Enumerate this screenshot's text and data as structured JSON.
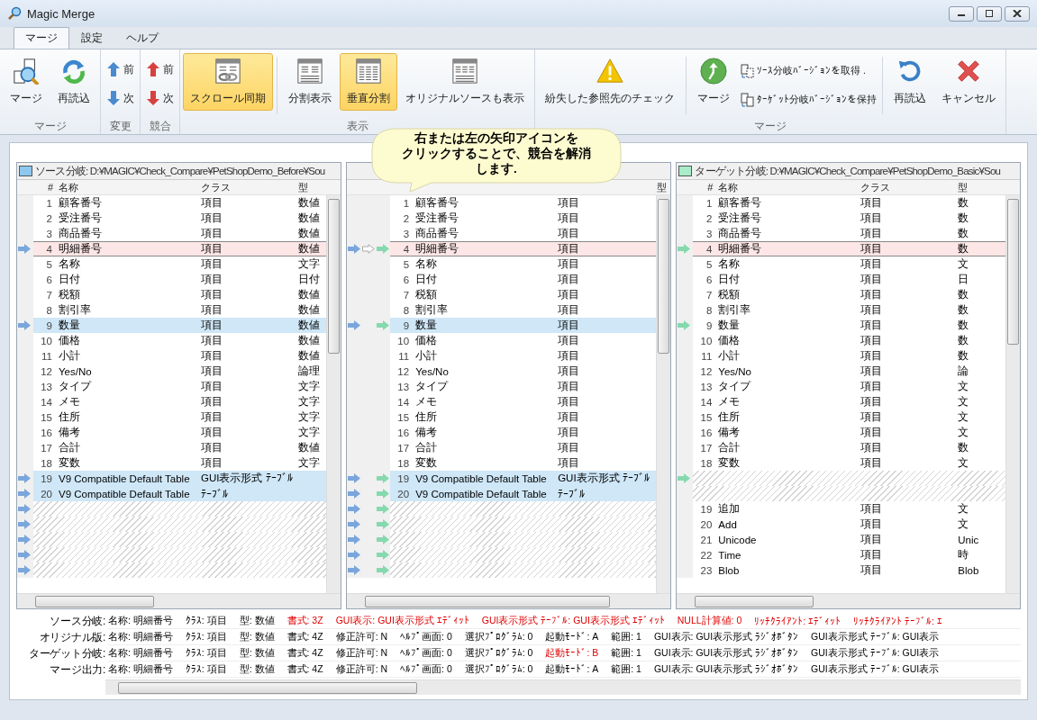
{
  "window": {
    "title": "Magic Merge"
  },
  "tabs": [
    {
      "label": "マージ",
      "selected": true
    },
    {
      "label": "設定",
      "selected": false
    },
    {
      "label": "ヘルプ",
      "selected": false
    }
  ],
  "ribbon": [
    {
      "label": "マージ",
      "items": [
        {
          "kind": "large",
          "label": "マージ",
          "selected": false
        },
        {
          "kind": "large",
          "label": "再読込",
          "selected": false
        }
      ]
    },
    {
      "label": "変更",
      "items": [
        {
          "kind": "small",
          "label": "前"
        },
        {
          "kind": "small",
          "label": "次"
        }
      ]
    },
    {
      "label": "競合",
      "items": [
        {
          "kind": "small",
          "label": "前"
        },
        {
          "kind": "small",
          "label": "次"
        }
      ]
    },
    {
      "label": "表示",
      "items": [
        {
          "kind": "large",
          "label": "スクロール同期",
          "selected": true
        },
        {
          "kind": "divider"
        },
        {
          "kind": "large",
          "label": "分割表示",
          "selected": false
        },
        {
          "kind": "large",
          "label": "垂直分割",
          "selected": true
        },
        {
          "kind": "large",
          "label": "オリジナルソースも表示",
          "selected": false
        }
      ]
    },
    {
      "label": "マージ",
      "items": [
        {
          "kind": "large",
          "label": "紛失した参照先のチェック",
          "selected": false
        },
        {
          "kind": "divider"
        },
        {
          "kind": "large",
          "label": "マージ",
          "selected": false
        },
        {
          "kind": "stack",
          "entries": [
            {
              "label": "ｿｰｽ分岐ﾊﾞｰｼﾞｮﾝを取得 ."
            },
            {
              "label": "ﾀｰｹﾞｯﾄ分岐ﾊﾞｰｼﾞｮﾝを保持"
            }
          ]
        },
        {
          "kind": "divider"
        },
        {
          "kind": "large",
          "label": "再読込",
          "selected": false
        },
        {
          "kind": "large",
          "label": "キャンセル",
          "selected": false
        }
      ]
    }
  ],
  "callout": {
    "lines": [
      "右または左の矢印アイコンを",
      "クリックすることで、競合を解消",
      "します."
    ]
  },
  "panels": [
    {
      "kind": "source",
      "title": "ソース分岐: D:¥MAGIC¥Check_Compare¥PetShopDemo_Before¥Sou",
      "columns": [
        "#",
        "名称",
        "クラス",
        "型"
      ],
      "rows": [
        {
          "kind": "row",
          "conflict": false,
          "changed": false,
          "source_arrow": false,
          "num": "1",
          "name": "顧客番号",
          "class": "項目",
          "type": "数値"
        },
        {
          "kind": "row",
          "conflict": false,
          "changed": false,
          "source_arrow": false,
          "num": "2",
          "name": "受注番号",
          "class": "項目",
          "type": "数値"
        },
        {
          "kind": "row",
          "conflict": false,
          "changed": false,
          "source_arrow": false,
          "num": "3",
          "name": "商品番号",
          "class": "項目",
          "type": "数値"
        },
        {
          "kind": "row",
          "conflict": true,
          "changed": false,
          "source_arrow": true,
          "num": "4",
          "name": "明細番号",
          "class": "項目",
          "type": "数値"
        },
        {
          "kind": "row",
          "conflict": false,
          "changed": false,
          "source_arrow": false,
          "num": "5",
          "name": "名称",
          "class": "項目",
          "type": "文字"
        },
        {
          "kind": "row",
          "conflict": false,
          "changed": false,
          "source_arrow": false,
          "num": "6",
          "name": "日付",
          "class": "項目",
          "type": "日付"
        },
        {
          "kind": "row",
          "conflict": false,
          "changed": false,
          "source_arrow": false,
          "num": "7",
          "name": "税額",
          "class": "項目",
          "type": "数値"
        },
        {
          "kind": "row",
          "conflict": false,
          "changed": false,
          "source_arrow": false,
          "num": "8",
          "name": "割引率",
          "class": "項目",
          "type": "数値"
        },
        {
          "kind": "row",
          "conflict": false,
          "changed": true,
          "source_arrow": true,
          "num": "9",
          "name": "数量",
          "class": "項目",
          "type": "数値"
        },
        {
          "kind": "row",
          "conflict": false,
          "changed": false,
          "source_arrow": false,
          "num": "10",
          "name": "価格",
          "class": "項目",
          "type": "数値"
        },
        {
          "kind": "row",
          "conflict": false,
          "changed": false,
          "source_arrow": false,
          "num": "11",
          "name": "小計",
          "class": "項目",
          "type": "数値"
        },
        {
          "kind": "row",
          "conflict": false,
          "changed": false,
          "source_arrow": false,
          "num": "12",
          "name": "Yes/No",
          "class": "項目",
          "type": "論理"
        },
        {
          "kind": "row",
          "conflict": false,
          "changed": false,
          "source_arrow": false,
          "num": "13",
          "name": "タイプ",
          "class": "項目",
          "type": "文字"
        },
        {
          "kind": "row",
          "conflict": false,
          "changed": false,
          "source_arrow": false,
          "num": "14",
          "name": "メモ",
          "class": "項目",
          "type": "文字"
        },
        {
          "kind": "row",
          "conflict": false,
          "changed": false,
          "source_arrow": false,
          "num": "15",
          "name": "住所",
          "class": "項目",
          "type": "文字"
        },
        {
          "kind": "row",
          "conflict": false,
          "changed": false,
          "source_arrow": false,
          "num": "16",
          "name": "備考",
          "class": "項目",
          "type": "文字"
        },
        {
          "kind": "row",
          "conflict": false,
          "changed": false,
          "source_arrow": false,
          "num": "17",
          "name": "合計",
          "class": "項目",
          "type": "数値"
        },
        {
          "kind": "row",
          "conflict": false,
          "changed": false,
          "source_arrow": false,
          "num": "18",
          "name": "変数",
          "class": "項目",
          "type": "文字"
        },
        {
          "kind": "row",
          "conflict": false,
          "changed": true,
          "source_arrow": true,
          "num": "19",
          "name": "V9 Compatible Default Table",
          "class": "GUI表示形式 ﾃｰﾌﾞﾙ"
        },
        {
          "kind": "row",
          "conflict": false,
          "changed": true,
          "source_arrow": true,
          "num": "20",
          "name": "V9 Compatible Default Table",
          "class": "ﾃｰﾌﾞﾙ"
        },
        {
          "kind": "empty",
          "source_arrow": true
        },
        {
          "kind": "empty",
          "source_arrow": true
        },
        {
          "kind": "empty",
          "source_arrow": true
        },
        {
          "kind": "empty",
          "source_arrow": true
        },
        {
          "kind": "empty",
          "source_arrow": true
        }
      ]
    },
    {
      "kind": "middle",
      "type_header": "型",
      "rows": [
        {
          "kind": "row",
          "conflict": false,
          "changed": false,
          "source_arrow": false,
          "original_arrow": false,
          "target_arrow": false,
          "num": "1",
          "name": "顧客番号",
          "class": "項目"
        },
        {
          "kind": "row",
          "conflict": false,
          "changed": false,
          "source_arrow": false,
          "original_arrow": false,
          "target_arrow": false,
          "num": "2",
          "name": "受注番号",
          "class": "項目"
        },
        {
          "kind": "row",
          "conflict": false,
          "changed": false,
          "source_arrow": false,
          "original_arrow": false,
          "target_arrow": false,
          "num": "3",
          "name": "商品番号",
          "class": "項目"
        },
        {
          "kind": "row",
          "conflict": true,
          "changed": false,
          "source_arrow": true,
          "original_arrow": true,
          "target_arrow": true,
          "num": "4",
          "name": "明細番号",
          "class": "項目"
        },
        {
          "kind": "row",
          "conflict": false,
          "changed": false,
          "source_arrow": false,
          "original_arrow": false,
          "target_arrow": false,
          "num": "5",
          "name": "名称",
          "class": "項目"
        },
        {
          "kind": "row",
          "conflict": false,
          "changed": false,
          "source_arrow": false,
          "original_arrow": false,
          "target_arrow": false,
          "num": "6",
          "name": "日付",
          "class": "項目"
        },
        {
          "kind": "row",
          "conflict": false,
          "changed": false,
          "source_arrow": false,
          "original_arrow": false,
          "target_arrow": false,
          "num": "7",
          "name": "税額",
          "class": "項目"
        },
        {
          "kind": "row",
          "conflict": false,
          "changed": false,
          "source_arrow": false,
          "original_arrow": false,
          "target_arrow": false,
          "num": "8",
          "name": "割引率",
          "class": "項目"
        },
        {
          "kind": "row",
          "conflict": false,
          "changed": true,
          "source_arrow": true,
          "original_arrow": false,
          "target_arrow": true,
          "num": "9",
          "name": "数量",
          "class": "項目"
        },
        {
          "kind": "row",
          "conflict": false,
          "changed": false,
          "source_arrow": false,
          "original_arrow": false,
          "target_arrow": false,
          "num": "10",
          "name": "価格",
          "class": "項目"
        },
        {
          "kind": "row",
          "conflict": false,
          "changed": false,
          "source_arrow": false,
          "original_arrow": false,
          "target_arrow": false,
          "num": "11",
          "name": "小計",
          "class": "項目"
        },
        {
          "kind": "row",
          "conflict": false,
          "changed": false,
          "source_arrow": false,
          "original_arrow": false,
          "target_arrow": false,
          "num": "12",
          "name": "Yes/No",
          "class": "項目"
        },
        {
          "kind": "row",
          "conflict": false,
          "changed": false,
          "source_arrow": false,
          "original_arrow": false,
          "target_arrow": false,
          "num": "13",
          "name": "タイプ",
          "class": "項目"
        },
        {
          "kind": "row",
          "conflict": false,
          "changed": false,
          "source_arrow": false,
          "original_arrow": false,
          "target_arrow": false,
          "num": "14",
          "name": "メモ",
          "class": "項目"
        },
        {
          "kind": "row",
          "conflict": false,
          "changed": false,
          "source_arrow": false,
          "original_arrow": false,
          "target_arrow": false,
          "num": "15",
          "name": "住所",
          "class": "項目"
        },
        {
          "kind": "row",
          "conflict": false,
          "changed": false,
          "source_arrow": false,
          "original_arrow": false,
          "target_arrow": false,
          "num": "16",
          "name": "備考",
          "class": "項目"
        },
        {
          "kind": "row",
          "conflict": false,
          "changed": false,
          "source_arrow": false,
          "original_arrow": false,
          "target_arrow": false,
          "num": "17",
          "name": "合計",
          "class": "項目"
        },
        {
          "kind": "row",
          "conflict": false,
          "changed": false,
          "source_arrow": false,
          "original_arrow": false,
          "target_arrow": false,
          "num": "18",
          "name": "変数",
          "class": "項目"
        },
        {
          "kind": "row",
          "conflict": false,
          "changed": true,
          "source_arrow": true,
          "original_arrow": false,
          "target_arrow": true,
          "num": "19",
          "name": "V9 Compatible Default Table",
          "class": "GUI表示形式 ﾃｰﾌﾞﾙ"
        },
        {
          "kind": "row",
          "conflict": false,
          "changed": true,
          "source_arrow": true,
          "original_arrow": false,
          "target_arrow": true,
          "num": "20",
          "name": "V9 Compatible Default Table",
          "class": "ﾃｰﾌﾞﾙ"
        },
        {
          "kind": "empty",
          "source_arrow": true,
          "original_arrow": false,
          "target_arrow": true
        },
        {
          "kind": "empty",
          "source_arrow": true,
          "original_arrow": false,
          "target_arrow": true
        },
        {
          "kind": "empty",
          "source_arrow": true,
          "original_arrow": false,
          "target_arrow": true
        },
        {
          "kind": "empty",
          "source_arrow": true,
          "original_arrow": false,
          "target_arrow": true
        },
        {
          "kind": "empty",
          "source_arrow": true,
          "original_arrow": false,
          "target_arrow": true
        }
      ]
    },
    {
      "kind": "target",
      "title": "ターゲット分岐: D:¥MAGIC¥Check_Compare¥PetShopDemo_Basic¥Sou",
      "columns": [
        "#",
        "名称",
        "クラス",
        "型"
      ],
      "rows": [
        {
          "kind": "row",
          "conflict": false,
          "changed": false,
          "target_arrow": false,
          "num": "1",
          "name": "顧客番号",
          "class": "項目",
          "type": "数"
        },
        {
          "kind": "row",
          "conflict": false,
          "changed": false,
          "target_arrow": false,
          "num": "2",
          "name": "受注番号",
          "class": "項目",
          "type": "数"
        },
        {
          "kind": "row",
          "conflict": false,
          "changed": false,
          "target_arrow": false,
          "num": "3",
          "name": "商品番号",
          "class": "項目",
          "type": "数"
        },
        {
          "kind": "row",
          "conflict": true,
          "changed": false,
          "target_arrow": true,
          "num": "4",
          "name": "明細番号",
          "class": "項目",
          "type": "数"
        },
        {
          "kind": "row",
          "conflict": false,
          "changed": false,
          "target_arrow": false,
          "num": "5",
          "name": "名称",
          "class": "項目",
          "type": "文"
        },
        {
          "kind": "row",
          "conflict": false,
          "changed": false,
          "target_arrow": false,
          "num": "6",
          "name": "日付",
          "class": "項目",
          "type": "日"
        },
        {
          "kind": "row",
          "conflict": false,
          "changed": false,
          "target_arrow": false,
          "num": "7",
          "name": "税額",
          "class": "項目",
          "type": "数"
        },
        {
          "kind": "row",
          "conflict": false,
          "changed": false,
          "target_arrow": false,
          "num": "8",
          "name": "割引率",
          "class": "項目",
          "type": "数"
        },
        {
          "kind": "row",
          "conflict": false,
          "changed": false,
          "target_arrow": true,
          "num": "9",
          "name": "数量",
          "class": "項目",
          "type": "数"
        },
        {
          "kind": "row",
          "conflict": false,
          "changed": false,
          "target_arrow": false,
          "num": "10",
          "name": "価格",
          "class": "項目",
          "type": "数"
        },
        {
          "kind": "row",
          "conflict": false,
          "changed": false,
          "target_arrow": false,
          "num": "11",
          "name": "小計",
          "class": "項目",
          "type": "数"
        },
        {
          "kind": "row",
          "conflict": false,
          "changed": false,
          "target_arrow": false,
          "num": "12",
          "name": "Yes/No",
          "class": "項目",
          "type": "論"
        },
        {
          "kind": "row",
          "conflict": false,
          "changed": false,
          "target_arrow": false,
          "num": "13",
          "name": "タイプ",
          "class": "項目",
          "type": "文"
        },
        {
          "kind": "row",
          "conflict": false,
          "changed": false,
          "target_arrow": false,
          "num": "14",
          "name": "メモ",
          "class": "項目",
          "type": "文"
        },
        {
          "kind": "row",
          "conflict": false,
          "changed": false,
          "target_arrow": false,
          "num": "15",
          "name": "住所",
          "class": "項目",
          "type": "文"
        },
        {
          "kind": "row",
          "conflict": false,
          "changed": false,
          "target_arrow": false,
          "num": "16",
          "name": "備考",
          "class": "項目",
          "type": "文"
        },
        {
          "kind": "row",
          "conflict": false,
          "changed": false,
          "target_arrow": false,
          "num": "17",
          "name": "合計",
          "class": "項目",
          "type": "数"
        },
        {
          "kind": "row",
          "conflict": false,
          "changed": false,
          "target_arrow": false,
          "num": "18",
          "name": "変数",
          "class": "項目",
          "type": "文"
        },
        {
          "kind": "empty",
          "target_arrow": true
        },
        {
          "kind": "empty",
          "target_arrow": false
        },
        {
          "kind": "row",
          "conflict": false,
          "changed": false,
          "target_arrow": false,
          "num": "19",
          "name": "追加",
          "class": "項目",
          "type": "文"
        },
        {
          "kind": "row",
          "conflict": false,
          "changed": false,
          "target_arrow": false,
          "num": "20",
          "name": "Add",
          "class": "項目",
          "type": "文"
        },
        {
          "kind": "row",
          "conflict": false,
          "changed": false,
          "target_arrow": false,
          "num": "21",
          "name": "Unicode",
          "class": "項目",
          "type": "Unic"
        },
        {
          "kind": "row",
          "conflict": false,
          "changed": false,
          "target_arrow": false,
          "num": "22",
          "name": "Time",
          "class": "項目",
          "type": "時"
        },
        {
          "kind": "row",
          "conflict": false,
          "changed": false,
          "target_arrow": false,
          "num": "23",
          "name": "Blob",
          "class": "項目",
          "type": "Blob"
        }
      ]
    }
  ],
  "details": [
    {
      "label": "ソース分岐:",
      "fields": [
        {
          "text": "名称: 明細番号",
          "changed": false
        },
        {
          "text": "ｸﾗｽ: 項目",
          "changed": false
        },
        {
          "text": "型: 数値",
          "changed": false
        },
        {
          "text": "書式: 3Z",
          "changed": true
        },
        {
          "text": "GUI表示: GUI表示形式 ｴﾃﾞｨｯﾄ",
          "changed": true
        },
        {
          "text": "GUI表示形式 ﾃｰﾌﾞﾙ: GUI表示形式 ｴﾃﾞｨｯﾄ",
          "changed": true
        },
        {
          "text": "NULL計算値: 0",
          "changed": true
        },
        {
          "text": "ﾘｯﾁｸﾗｲｱﾝﾄ: ｴﾃﾞｨｯﾄ",
          "changed": true
        },
        {
          "text": "ﾘｯﾁｸﾗｲｱﾝﾄ ﾃｰﾌﾞﾙ: ｴ",
          "changed": true
        }
      ]
    },
    {
      "label": "オリジナル版:",
      "fields": [
        {
          "text": "名称: 明細番号",
          "changed": false
        },
        {
          "text": "ｸﾗｽ: 項目",
          "changed": false
        },
        {
          "text": "型: 数値",
          "changed": false
        },
        {
          "text": "書式: 4Z",
          "changed": false
        },
        {
          "text": "修正許可: N",
          "changed": false
        },
        {
          "text": "ﾍﾙﾌﾟ画面: 0",
          "changed": false
        },
        {
          "text": "選択ﾌﾟﾛｸﾞﾗﾑ: 0",
          "changed": false
        },
        {
          "text": "起動ﾓｰﾄﾞ: A",
          "changed": false
        },
        {
          "text": "範囲: 1",
          "changed": false
        },
        {
          "text": "GUI表示: GUI表示形式 ﾗｼﾞｵﾎﾞﾀﾝ",
          "changed": false
        },
        {
          "text": "GUI表示形式 ﾃｰﾌﾞﾙ: GUI表示",
          "changed": false
        }
      ]
    },
    {
      "label": "ターゲット分岐:",
      "fields": [
        {
          "text": "名称: 明細番号",
          "changed": false
        },
        {
          "text": "ｸﾗｽ: 項目",
          "changed": false
        },
        {
          "text": "型: 数値",
          "changed": false
        },
        {
          "text": "書式: 4Z",
          "changed": false
        },
        {
          "text": "修正許可: N",
          "changed": false
        },
        {
          "text": "ﾍﾙﾌﾟ画面: 0",
          "changed": false
        },
        {
          "text": "選択ﾌﾟﾛｸﾞﾗﾑ: 0",
          "changed": false
        },
        {
          "text": "起動ﾓｰﾄﾞ: B",
          "changed": true
        },
        {
          "text": "範囲: 1",
          "changed": false
        },
        {
          "text": "GUI表示: GUI表示形式 ﾗｼﾞｵﾎﾞﾀﾝ",
          "changed": false
        },
        {
          "text": "GUI表示形式 ﾃｰﾌﾞﾙ: GUI表示",
          "changed": false
        }
      ]
    },
    {
      "label": "マージ出力:",
      "fields": [
        {
          "text": "名称: 明細番号",
          "changed": false
        },
        {
          "text": "ｸﾗｽ: 項目",
          "changed": false
        },
        {
          "text": "型: 数値",
          "changed": false
        },
        {
          "text": "書式: 4Z",
          "changed": false
        },
        {
          "text": "修正許可: N",
          "changed": false
        },
        {
          "text": "ﾍﾙﾌﾟ画面: 0",
          "changed": false
        },
        {
          "text": "選択ﾌﾟﾛｸﾞﾗﾑ: 0",
          "changed": false
        },
        {
          "text": "起動ﾓｰﾄﾞ: A",
          "changed": false
        },
        {
          "text": "範囲: 1",
          "changed": false
        },
        {
          "text": "GUI表示: GUI表示形式 ﾗｼﾞｵﾎﾞﾀﾝ",
          "changed": false
        },
        {
          "text": "GUI表示形式 ﾃｰﾌﾞﾙ: GUI表示",
          "changed": false
        }
      ]
    }
  ]
}
